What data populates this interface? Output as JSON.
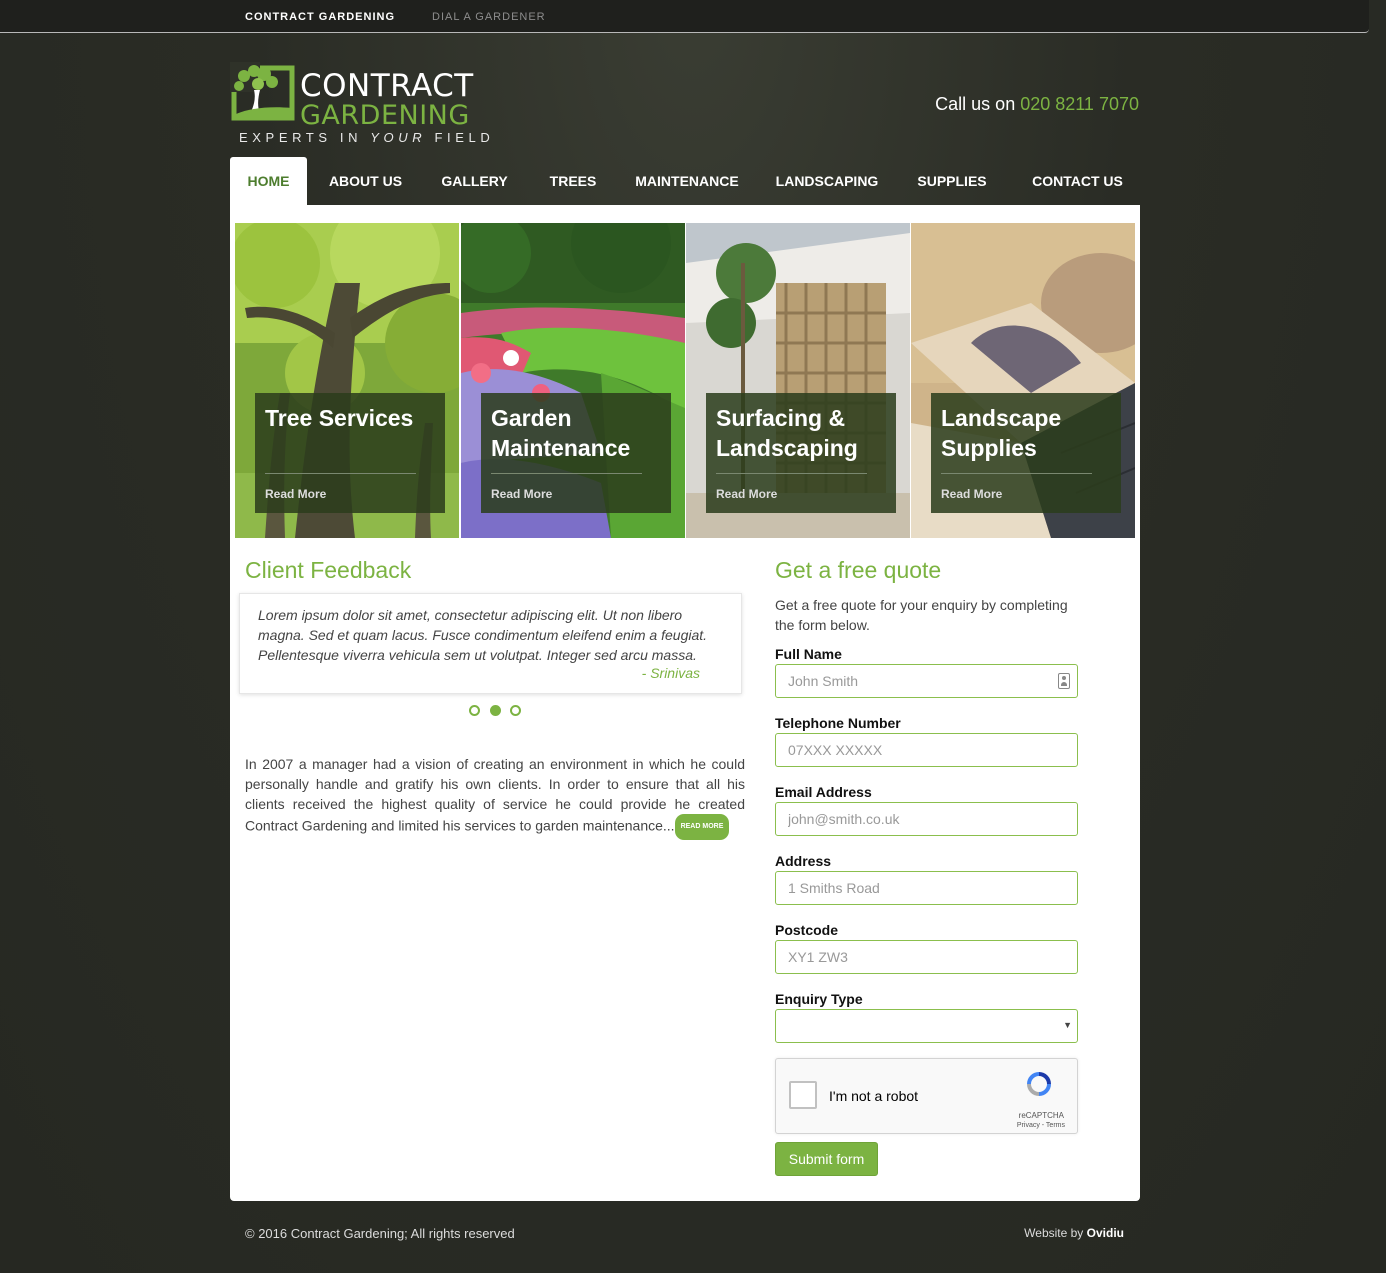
{
  "topbar": {
    "links": [
      "Contract Gardening",
      "Dial a Gardener"
    ]
  },
  "brand": {
    "word1": "CONTRACT",
    "word2": "GARDENING",
    "tag_pre": "EXPERTS IN ",
    "tag_em": "YOUR",
    "tag_post": " FIELD",
    "logo_icon": "tree-icon"
  },
  "phone": {
    "prefix": "Call us on ",
    "number": "020 8211 7070"
  },
  "nav": {
    "items": [
      "Home",
      "About Us",
      "Gallery",
      "Trees",
      "Maintenance",
      "Landscaping",
      "Supplies",
      "Contact Us"
    ],
    "active": "Home"
  },
  "tiles": [
    {
      "title": "Tree Services",
      "more": "Read More"
    },
    {
      "title": "Garden Maintenance",
      "more": "Read More"
    },
    {
      "title": "Surfacing & Landscaping",
      "more": "Read More"
    },
    {
      "title": "Landscape Supplies",
      "more": "Read More"
    }
  ],
  "feedback": {
    "heading": "Client Feedback",
    "quote": "Lorem ipsum dolor sit amet, consectetur adipiscing elit. Ut non libero magna. Sed et quam lacus. Fusce condimentum eleifend enim a feugiat. Pellentesque viverra vehicula sem ut volutpat. Integer sed arcu massa.",
    "author": "- Srinivas",
    "slide_count": 3,
    "active_slide": 2
  },
  "about": {
    "text": "In 2007 a manager had a vision of creating an environment in which he could personally handle and gratify his own clients. In order to ensure that all his clients received the highest quality of service he could provide he created Contract Gardening and limited his services to garden maintenance...",
    "read_more": "Read More"
  },
  "quote_form": {
    "heading": "Get a free quote",
    "intro": "Get a free quote for your enquiry by completing the form below.",
    "full_name": {
      "label": "Full Name",
      "placeholder": "John Smith",
      "value": ""
    },
    "telephone": {
      "label": "Telephone Number",
      "placeholder": "07XXX XXXXX",
      "value": ""
    },
    "email": {
      "label": "Email Address",
      "placeholder": "john@smith.co.uk",
      "value": ""
    },
    "address": {
      "label": "Address",
      "placeholder": "1 Smiths Road",
      "value": ""
    },
    "postcode": {
      "label": "Postcode",
      "placeholder": "XY1 ZW3",
      "value": ""
    },
    "enquiry_type": {
      "label": "Enquiry Type",
      "selected": ""
    },
    "captcha": {
      "text": "I'm not a robot",
      "brand": "reCAPTCHA",
      "terms": "Privacy - Terms"
    },
    "submit": "Submit form"
  },
  "footer": {
    "copyright": "© 2016 Contract Gardening; All rights reserved",
    "credit_prefix": "Website by ",
    "credit_name": "Ovidiu"
  },
  "colors": {
    "accent": "#7cb342",
    "background": "#2a2c25",
    "caption_overlay": "#2b3d1c"
  }
}
